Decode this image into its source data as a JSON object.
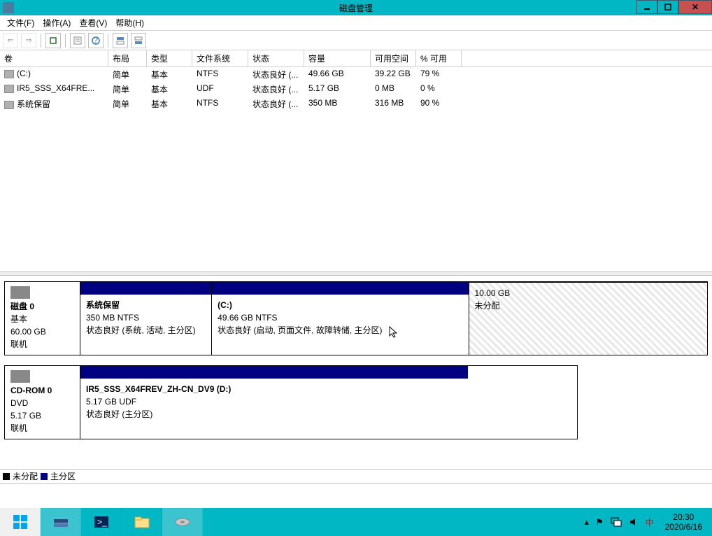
{
  "window": {
    "title": "磁盘管理"
  },
  "menu": {
    "file": "文件(F)",
    "action": "操作(A)",
    "view": "查看(V)",
    "help": "帮助(H)"
  },
  "grid": {
    "headers": {
      "volume": "卷",
      "layout": "布局",
      "type": "类型",
      "fs": "文件系统",
      "status": "状态",
      "capacity": "容量",
      "free": "可用空间",
      "pct": "% 可用"
    },
    "rows": [
      {
        "volume": "(C:)",
        "layout": "简单",
        "type": "基本",
        "fs": "NTFS",
        "status": "状态良好 (...",
        "capacity": "49.66 GB",
        "free": "39.22 GB",
        "pct": "79 %"
      },
      {
        "volume": "IR5_SSS_X64FRE...",
        "layout": "简单",
        "type": "基本",
        "fs": "UDF",
        "status": "状态良好 (...",
        "capacity": "5.17 GB",
        "free": "0 MB",
        "pct": "0 %"
      },
      {
        "volume": "系统保留",
        "layout": "简单",
        "type": "基本",
        "fs": "NTFS",
        "status": "状态良好 (...",
        "capacity": "350 MB",
        "free": "316 MB",
        "pct": "90 %"
      }
    ]
  },
  "disks": [
    {
      "title": "磁盘 0",
      "type": "基本",
      "size": "60.00 GB",
      "state": "联机",
      "parts": [
        {
          "kind": "primary",
          "widthPct": 21,
          "name": "系统保留",
          "sub": "350 MB NTFS",
          "status": "状态良好 (系统, 活动, 主分区)"
        },
        {
          "kind": "primary",
          "widthPct": 41,
          "name": "(C:)",
          "sub": "49.66 GB NTFS",
          "status": "状态良好 (启动, 页面文件, 故障转储, 主分区)"
        },
        {
          "kind": "unalloc",
          "widthPct": 38,
          "name": "",
          "sub": "10.00 GB",
          "status": "未分配"
        }
      ]
    },
    {
      "title": "CD-ROM 0",
      "type": "DVD",
      "size": "5.17 GB",
      "state": "联机",
      "parts": [
        {
          "kind": "primary",
          "widthPct": 78,
          "name": "IR5_SSS_X64FREV_ZH-CN_DV9  (D:)",
          "sub": "5.17 GB UDF",
          "status": "状态良好 (主分区)"
        }
      ]
    }
  ],
  "legend": {
    "unalloc": "未分配",
    "primary": "主分区"
  },
  "tray": {
    "time": "20:30",
    "date": "2020/6/16"
  }
}
